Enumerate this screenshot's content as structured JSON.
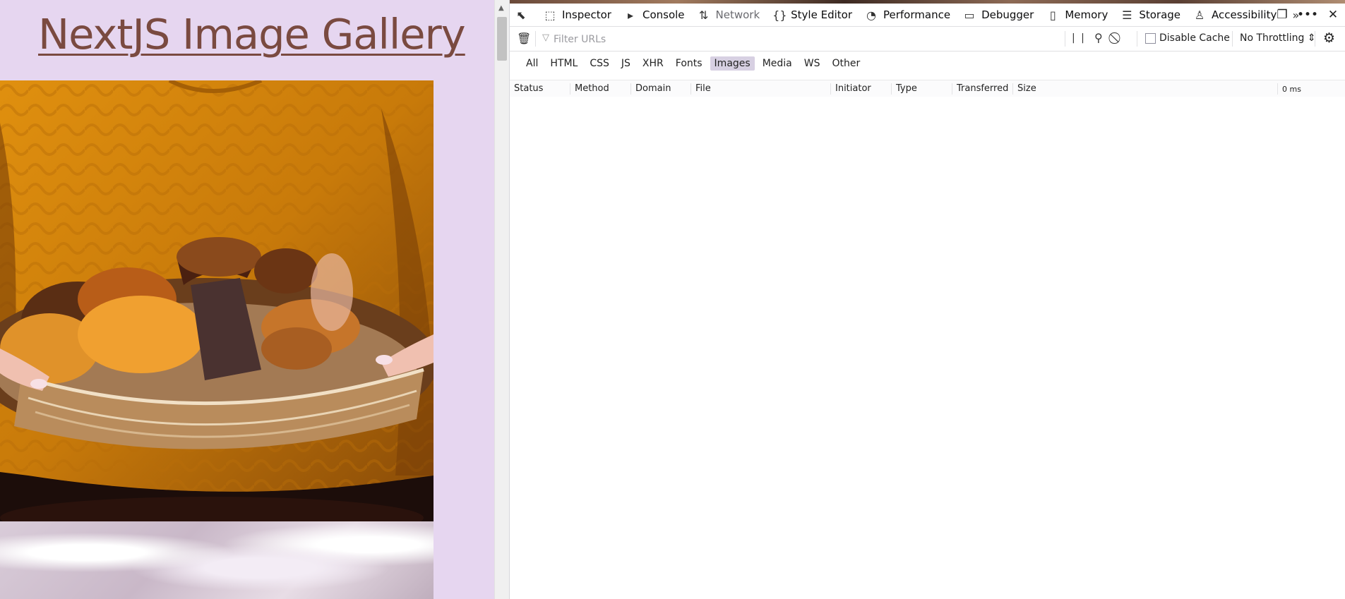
{
  "page": {
    "title": "NextJS Image Gallery",
    "colors": {
      "background": "#e6d6f0",
      "title": "#7a4a40"
    }
  },
  "toolbox": {
    "tabs": [
      {
        "label": "Inspector",
        "icon": "inspector-icon"
      },
      {
        "label": "Console",
        "icon": "console-icon"
      },
      {
        "label": "Network",
        "icon": "network-icon",
        "selected": true
      },
      {
        "label": "Style Editor",
        "icon": "style-editor-icon"
      },
      {
        "label": "Performance",
        "icon": "performance-icon"
      },
      {
        "label": "Debugger",
        "icon": "debugger-icon"
      },
      {
        "label": "Memory",
        "icon": "memory-icon"
      },
      {
        "label": "Storage",
        "icon": "storage-icon"
      },
      {
        "label": "Accessibility",
        "icon": "accessibility-icon"
      }
    ]
  },
  "network": {
    "filter_placeholder": "Filter URLs",
    "disable_cache_label": "Disable Cache",
    "disable_cache_checked": false,
    "throttling": "No Throttling ⇕",
    "type_filters": [
      {
        "label": "All"
      },
      {
        "label": "HTML"
      },
      {
        "label": "CSS"
      },
      {
        "label": "JS"
      },
      {
        "label": "XHR"
      },
      {
        "label": "Fonts"
      },
      {
        "label": "Images",
        "checked": true
      },
      {
        "label": "Media"
      },
      {
        "label": "WS"
      },
      {
        "label": "Other"
      }
    ],
    "columns": {
      "status": "Status",
      "method": "Method",
      "domain": "Domain",
      "file": "File",
      "initiator": "Initiator",
      "type": "Type",
      "transferred": "Transferred",
      "size": "Size",
      "waterfall": "0 ms"
    },
    "requests": []
  }
}
